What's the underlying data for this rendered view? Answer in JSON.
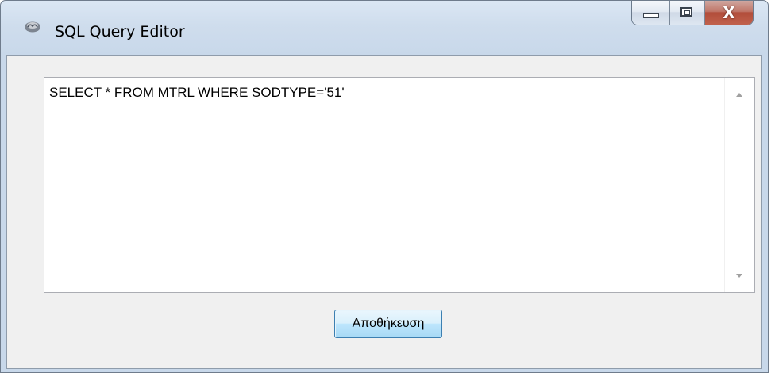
{
  "window": {
    "title": "SQL Query Editor",
    "app_icon": "app-icon",
    "caption_buttons": {
      "minimize_icon": "minimize-icon",
      "maximize_icon": "maximize-icon",
      "close_label": "X"
    }
  },
  "editor": {
    "value": "SELECT * FROM MTRL WHERE SODTYPE='51'",
    "scroll_up_icon": "scroll-up-arrow-icon",
    "scroll_down_icon": "scroll-down-arrow-icon"
  },
  "actions": {
    "save_label": "Αποθήκευση"
  },
  "colors": {
    "title_bar": "#cfdded",
    "client_bg": "#f0f0f0",
    "close_button": "#c0614c",
    "save_button_border": "#3c7fb1"
  }
}
